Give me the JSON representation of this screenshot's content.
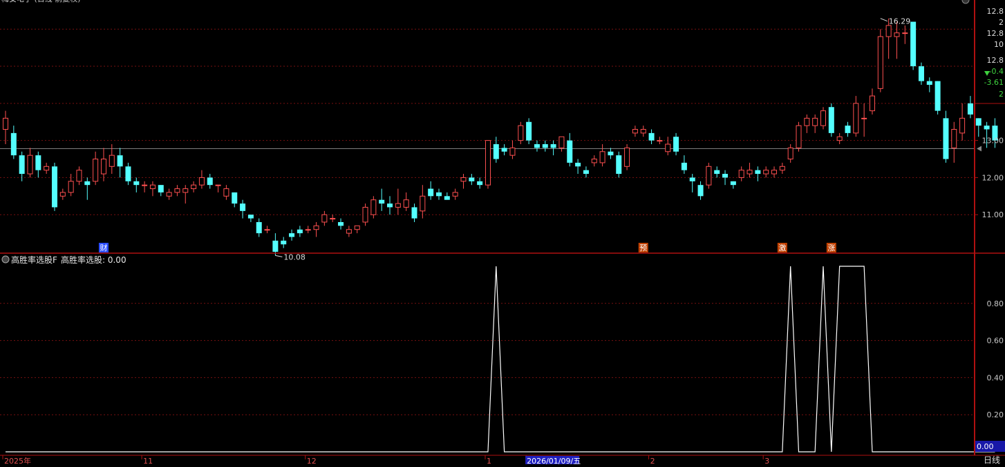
{
  "window_title": "梅安电子 (日线 前复权)",
  "colors": {
    "up": "#ff5050",
    "down": "#54ffff",
    "grid": "#7a1010",
    "axis_text": "#c8c8c8",
    "indicator_line": "#ffffff",
    "date_highlight": "#2020c0"
  },
  "price_panel": {
    "high_marker": "16.29",
    "low_marker": "10.08",
    "right_axis_labels": [
      "12.8",
      "2",
      "12.8",
      "10",
      "12.8",
      "-0.4",
      "-3.61",
      "2"
    ],
    "y_tick_labels": [
      "13.00",
      "12.00",
      "11.00"
    ],
    "event_tags": [
      "财",
      "预",
      "激",
      "涨"
    ]
  },
  "indicator_panel": {
    "name": "高胜率选股F",
    "series_label": "高胜率选股: 0.00",
    "y_tick_labels": [
      "0.80",
      "0.60",
      "0.40",
      "0.20"
    ],
    "current_value": "0.00"
  },
  "x_axis": {
    "labels": [
      "2025年",
      "11",
      "12",
      "1",
      "2026/01/09/五",
      "2",
      "3"
    ],
    "period": "日线"
  },
  "chart_data": [
    {
      "type": "candlestick",
      "title": "",
      "ylim": [
        10,
        16.6
      ],
      "candles": [
        [
          13.3,
          13.6,
          12.9,
          13.8
        ],
        [
          13.2,
          12.6,
          12.5,
          13.4
        ],
        [
          12.6,
          12.1,
          11.9,
          12.7
        ],
        [
          12.1,
          12.6,
          12.0,
          12.8
        ],
        [
          12.6,
          12.2,
          12.0,
          12.7
        ],
        [
          12.2,
          12.3,
          12.1,
          12.4
        ],
        [
          12.3,
          11.2,
          11.1,
          12.4
        ],
        [
          11.5,
          11.6,
          11.4,
          11.7
        ],
        [
          11.6,
          11.9,
          11.5,
          12.1
        ],
        [
          11.9,
          12.2,
          11.8,
          12.3
        ],
        [
          11.9,
          11.8,
          11.4,
          12.0
        ],
        [
          11.9,
          12.5,
          11.8,
          12.7
        ],
        [
          12.1,
          12.5,
          11.9,
          12.8
        ],
        [
          12.3,
          12.6,
          12.1,
          12.9
        ],
        [
          12.6,
          12.3,
          12.0,
          12.8
        ],
        [
          12.3,
          11.9,
          11.8,
          12.4
        ],
        [
          11.9,
          11.8,
          11.6,
          12.0
        ],
        [
          11.8,
          11.8,
          11.6,
          11.9
        ],
        [
          11.7,
          11.8,
          11.5,
          11.9
        ],
        [
          11.8,
          11.6,
          11.5,
          11.8
        ],
        [
          11.5,
          11.6,
          11.4,
          11.7
        ],
        [
          11.6,
          11.7,
          11.5,
          11.8
        ],
        [
          11.6,
          11.7,
          11.3,
          11.8
        ],
        [
          11.7,
          11.8,
          11.6,
          11.9
        ],
        [
          11.8,
          12.0,
          11.7,
          12.2
        ],
        [
          12.0,
          11.8,
          11.7,
          12.1
        ],
        [
          11.8,
          11.8,
          11.6,
          11.8
        ],
        [
          11.5,
          11.7,
          11.4,
          11.8
        ],
        [
          11.6,
          11.3,
          11.2,
          11.6
        ],
        [
          11.3,
          11.1,
          10.9,
          11.4
        ],
        [
          11.0,
          10.9,
          10.8,
          11.0
        ],
        [
          10.8,
          10.5,
          10.4,
          10.9
        ],
        [
          10.6,
          10.6,
          10.5,
          10.7
        ],
        [
          10.3,
          10.0,
          9.9,
          10.5
        ],
        [
          10.3,
          10.2,
          10.1,
          10.4
        ],
        [
          10.5,
          10.4,
          10.3,
          10.6
        ],
        [
          10.6,
          10.5,
          10.4,
          10.7
        ],
        [
          10.6,
          10.6,
          10.5,
          10.7
        ],
        [
          10.6,
          10.7,
          10.4,
          10.8
        ],
        [
          10.8,
          11.0,
          10.7,
          11.1
        ],
        [
          10.9,
          10.9,
          10.8,
          11.0
        ],
        [
          10.8,
          10.7,
          10.6,
          10.9
        ],
        [
          10.5,
          10.6,
          10.4,
          10.7
        ],
        [
          10.6,
          10.7,
          10.5,
          10.7
        ],
        [
          10.8,
          11.2,
          10.7,
          11.3
        ],
        [
          11.0,
          11.4,
          10.9,
          11.5
        ],
        [
          11.4,
          11.3,
          11.1,
          11.7
        ],
        [
          11.3,
          11.2,
          11.0,
          11.5
        ],
        [
          11.2,
          11.3,
          11.0,
          11.7
        ],
        [
          11.2,
          11.4,
          11.1,
          11.6
        ],
        [
          11.2,
          10.9,
          10.8,
          11.3
        ],
        [
          11.1,
          11.5,
          10.9,
          11.8
        ],
        [
          11.7,
          11.5,
          11.4,
          11.9
        ],
        [
          11.6,
          11.5,
          11.4,
          11.7
        ],
        [
          11.5,
          11.4,
          11.4,
          11.6
        ],
        [
          11.5,
          11.6,
          11.4,
          11.7
        ],
        [
          11.9,
          12.0,
          11.7,
          12.1
        ],
        [
          12.0,
          11.9,
          11.8,
          12.1
        ],
        [
          11.9,
          11.8,
          11.7,
          12.0
        ],
        [
          11.8,
          13.0,
          11.7,
          13.0
        ],
        [
          12.9,
          12.5,
          12.4,
          13.1
        ],
        [
          12.8,
          12.7,
          12.6,
          12.9
        ],
        [
          12.6,
          12.8,
          12.5,
          13.0
        ],
        [
          13.0,
          13.4,
          12.9,
          13.5
        ],
        [
          13.5,
          13.0,
          12.9,
          13.6
        ],
        [
          12.9,
          12.8,
          12.7,
          13.0
        ],
        [
          12.9,
          12.8,
          12.7,
          13.0
        ],
        [
          12.9,
          12.8,
          12.6,
          13.0
        ],
        [
          12.8,
          13.1,
          12.7,
          13.1
        ],
        [
          13.0,
          12.4,
          12.3,
          13.2
        ],
        [
          12.4,
          12.3,
          12.1,
          12.5
        ],
        [
          12.2,
          12.1,
          12.0,
          12.3
        ],
        [
          12.4,
          12.5,
          12.3,
          12.6
        ],
        [
          12.4,
          12.7,
          12.3,
          12.9
        ],
        [
          12.7,
          12.6,
          12.5,
          12.8
        ],
        [
          12.6,
          12.1,
          12.0,
          12.7
        ],
        [
          12.3,
          12.8,
          12.2,
          12.9
        ],
        [
          13.2,
          13.3,
          13.1,
          13.4
        ],
        [
          13.2,
          13.3,
          13.1,
          13.4
        ],
        [
          13.2,
          13.0,
          12.9,
          13.3
        ],
        [
          13.0,
          13.0,
          12.9,
          13.1
        ],
        [
          12.7,
          12.9,
          12.6,
          13.1
        ],
        [
          13.1,
          12.7,
          12.6,
          13.2
        ],
        [
          12.4,
          12.2,
          12.1,
          12.6
        ],
        [
          12.0,
          11.9,
          11.6,
          12.1
        ],
        [
          11.8,
          11.5,
          11.4,
          11.9
        ],
        [
          11.8,
          12.3,
          11.7,
          12.4
        ],
        [
          12.2,
          12.1,
          12.0,
          12.3
        ],
        [
          12.1,
          12.0,
          11.8,
          12.2
        ],
        [
          11.9,
          11.8,
          11.7,
          11.9
        ],
        [
          12.0,
          12.2,
          11.9,
          12.3
        ],
        [
          12.1,
          12.2,
          12.0,
          12.4
        ],
        [
          12.2,
          12.1,
          11.9,
          12.3
        ],
        [
          12.1,
          12.2,
          12.0,
          12.3
        ],
        [
          12.1,
          12.2,
          12.0,
          12.3
        ],
        [
          12.2,
          12.3,
          12.1,
          12.4
        ],
        [
          12.5,
          12.8,
          12.4,
          12.9
        ],
        [
          12.8,
          13.4,
          12.7,
          13.5
        ],
        [
          13.4,
          13.6,
          13.2,
          13.7
        ],
        [
          13.4,
          13.6,
          13.2,
          13.7
        ],
        [
          13.4,
          13.8,
          13.3,
          13.9
        ],
        [
          13.9,
          13.2,
          13.1,
          14.0
        ],
        [
          13.0,
          13.1,
          12.9,
          13.2
        ],
        [
          13.4,
          13.2,
          13.1,
          13.5
        ],
        [
          13.2,
          14.0,
          13.1,
          14.2
        ],
        [
          13.6,
          13.6,
          13.1,
          14.0
        ],
        [
          13.8,
          14.2,
          13.7,
          14.4
        ],
        [
          14.4,
          15.8,
          14.3,
          16.0
        ],
        [
          15.8,
          16.1,
          15.2,
          16.29
        ],
        [
          15.8,
          15.9,
          15.2,
          16.2
        ],
        [
          15.9,
          15.9,
          15.6,
          16.1
        ],
        [
          16.2,
          15.0,
          14.9,
          16.2
        ],
        [
          15.0,
          14.6,
          14.5,
          15.1
        ],
        [
          14.6,
          14.5,
          14.3,
          14.7
        ],
        [
          14.6,
          13.8,
          13.7,
          14.6
        ],
        [
          13.6,
          12.5,
          12.4,
          13.8
        ],
        [
          12.8,
          13.3,
          12.4,
          13.5
        ],
        [
          13.2,
          13.6,
          13.0,
          14.0
        ],
        [
          14.0,
          13.7,
          13.6,
          14.2
        ],
        [
          13.6,
          13.4,
          13.1,
          13.6
        ],
        [
          13.4,
          13.3,
          12.8,
          13.5
        ],
        [
          13.4,
          13.0,
          12.8,
          13.6
        ]
      ]
    },
    {
      "type": "line",
      "title": "",
      "ylim": [
        0,
        1
      ],
      "series": [
        {
          "name": "高胜率选股",
          "segments": [
            [
              59,
              59,
              0
            ],
            [
              60,
              60,
              1
            ],
            [
              61,
              61,
              0
            ],
            [
              95,
              95,
              0
            ],
            [
              96,
              96,
              1
            ],
            [
              97,
              98,
              0
            ],
            [
              99,
              99,
              0
            ],
            [
              100,
              100,
              1
            ],
            [
              101,
              101,
              0
            ],
            [
              102,
              102,
              1
            ],
            [
              105,
              105,
              1
            ],
            [
              106,
              106,
              0
            ]
          ]
        }
      ]
    }
  ]
}
